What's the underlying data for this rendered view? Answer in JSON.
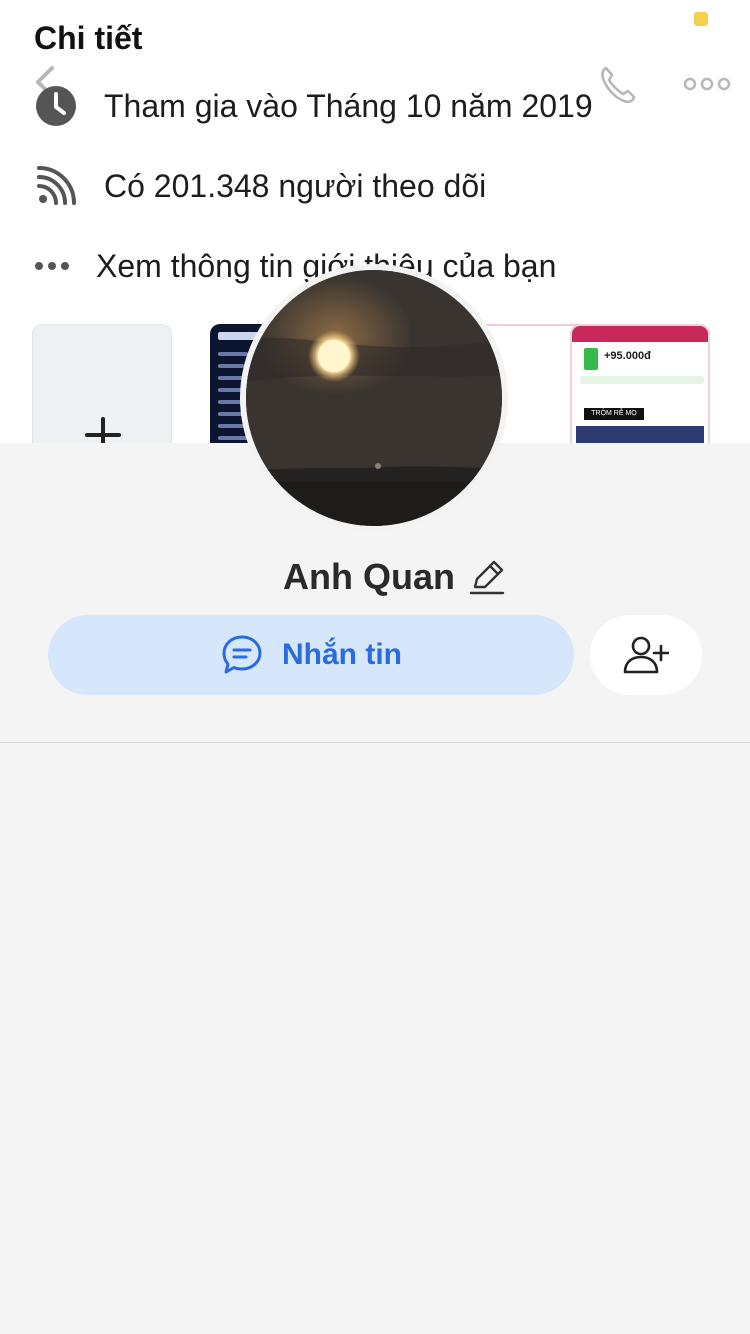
{
  "details": {
    "title": "Chi tiết",
    "joined": "Tham gia vào Tháng 10 năm 2019",
    "followers": "Có 201.348 người theo dõi",
    "intro": "Xem thông tin giới thiệu của bạn"
  },
  "icons": {
    "back": "chevron-left-icon",
    "call": "phone-icon",
    "more": "more-icon",
    "joined": "clock-icon",
    "followers": "rss-icon",
    "intro": "dots-icon",
    "add_photo": "plus-icon",
    "edit": "pencil-icon",
    "message": "chat-bubble-icon",
    "add_friend": "add-user-icon"
  },
  "thumbnails": {
    "app_amount": "+95.000đ",
    "app_banner": "TRỘM RỄ MỌ RẠE"
  },
  "profile": {
    "name": "Anh Quan"
  },
  "actions": {
    "message_label": "Nhắn tin"
  },
  "colors": {
    "accent": "#2a6be0",
    "message_bg": "#d6e6fb",
    "page_bg": "#f4f4f4",
    "status_dot": "#f5d04a"
  }
}
